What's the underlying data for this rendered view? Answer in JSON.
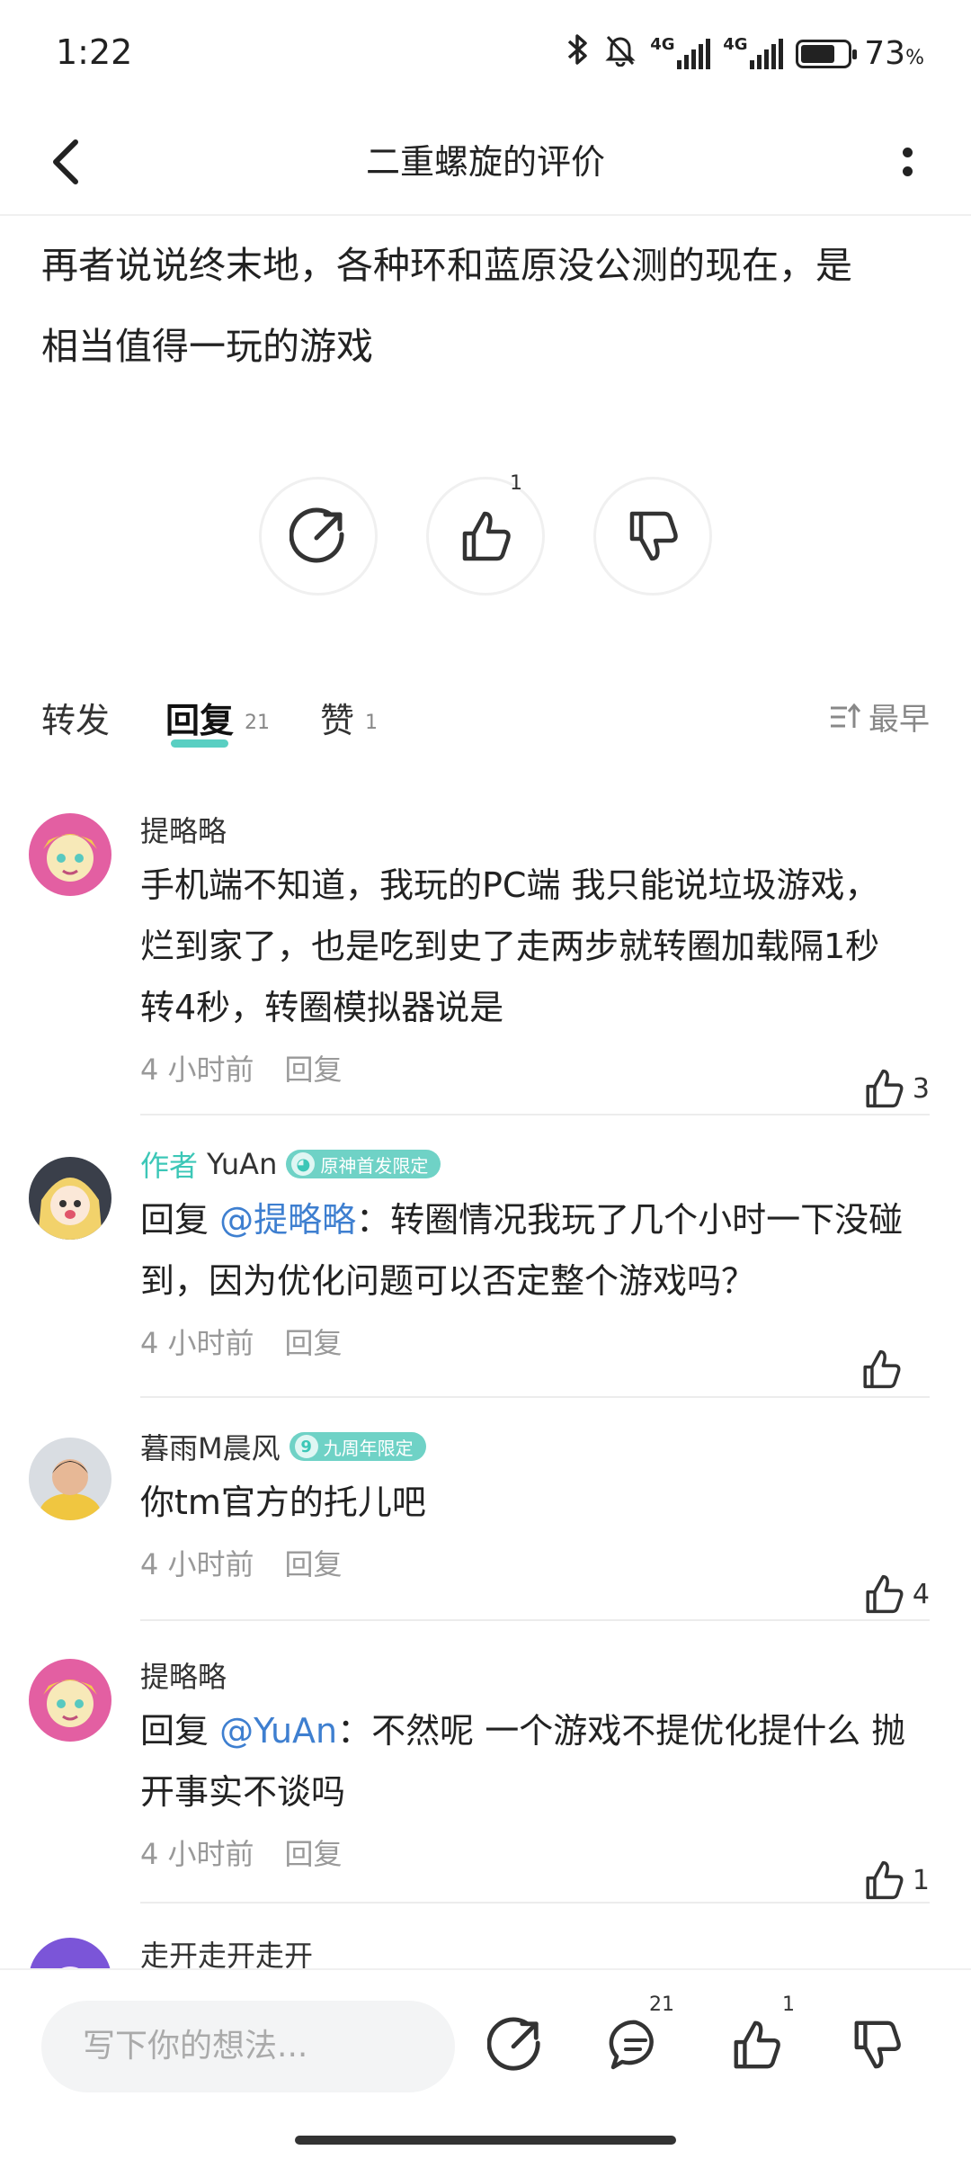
{
  "status_bar": {
    "time": "1:22",
    "network_1": "4G",
    "network_2": "4G",
    "battery": "73",
    "battery_unit": "%",
    "icons": [
      "bluetooth-icon",
      "mute-bell-icon",
      "signal-icon",
      "signal-icon",
      "battery-icon"
    ]
  },
  "header": {
    "title": "二重螺旋的评价",
    "back_icon": "back-arrow-icon",
    "more_icon": "more-vertical-icon"
  },
  "review": {
    "text_line1": "再者说说终末地，各种环和蓝原没公测的现在，是",
    "text_line2": "相当值得一玩的游戏"
  },
  "actions": {
    "share_icon": "share-icon",
    "like_icon": "thumbs-up-icon",
    "like_count": "1",
    "dislike_icon": "thumbs-down-icon"
  },
  "tabs": {
    "forward": "转发",
    "reply": "回复",
    "reply_count": "21",
    "likes": "赞",
    "likes_count": "1",
    "sort_label": "最早",
    "sort_icon": "sort-icon"
  },
  "comments": [
    {
      "name": "提略略",
      "text_lines": [
        "手机端不知道，我玩的PC端 我只能说垃圾游戏，",
        "烂到家了，也是吃到史了走两步就转圈加载隔1秒",
        "转4秒，转圈模拟器说是"
      ],
      "time": "4 小时前",
      "reply_label": "回复",
      "likes": "3"
    },
    {
      "author_tag": "作者",
      "name": "YuAn",
      "badge": "原神首发限定",
      "reply_prefix": "回复",
      "mention": "@提略略",
      "text_line1": "：转圈情况我玩了几个小时一下没碰",
      "text_line2": "到，因为优化问题可以否定整个游戏吗？",
      "time": "4 小时前",
      "reply_label": "回复",
      "likes": ""
    },
    {
      "name": "暮雨M晨风",
      "badge": "九周年限定",
      "badge_icon_text": "9",
      "text_lines": [
        "你tm官方的托儿吧"
      ],
      "time": "4 小时前",
      "reply_label": "回复",
      "likes": "4"
    },
    {
      "name": "提略略",
      "reply_prefix": "回复",
      "mention": "@YuAn",
      "text_line1": "：不然呢 一个游戏不提优化提什么 抛",
      "text_line2": "开事实不谈吗",
      "time": "4 小时前",
      "reply_label": "回复",
      "likes": "1"
    },
    {
      "name": "走开走开走开"
    }
  ],
  "bottom_bar": {
    "placeholder": "写下你的想法...",
    "comment_count": "21",
    "like_count": "1"
  },
  "colors": {
    "accent": "#3cc7b7",
    "mention": "#3e7fd0",
    "meta": "#999999"
  }
}
